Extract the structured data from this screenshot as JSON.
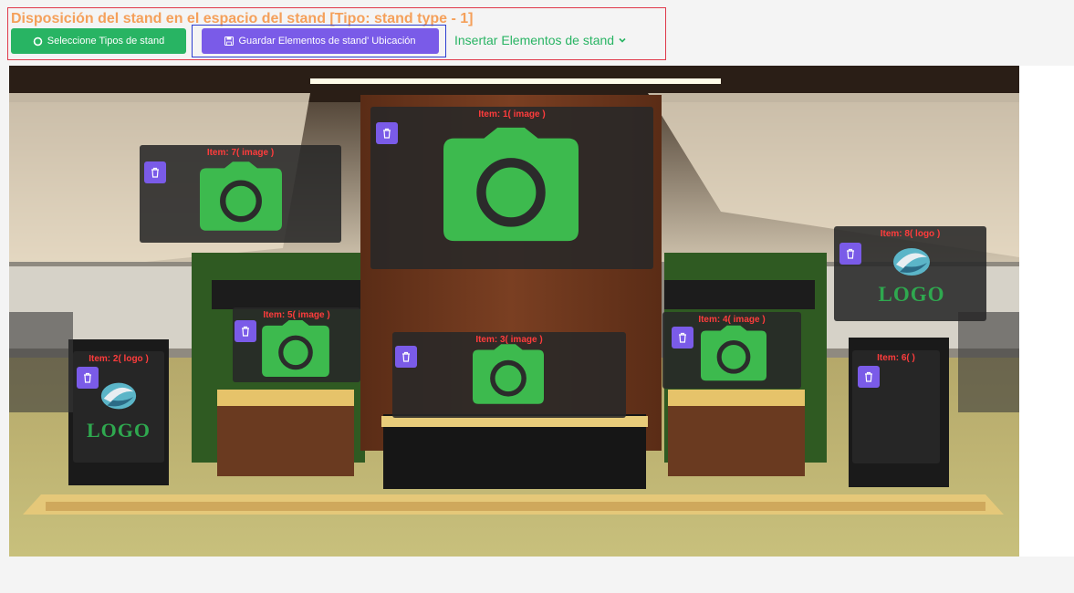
{
  "page": {
    "title": "Disposición del stand en el espacio del stand [Tipo: stand type - 1]"
  },
  "toolbar": {
    "select_types_label": "Seleccione Tipos de stand",
    "save_label": "Guardar Elementos de stand' Ubicación",
    "insert_label": "Insertar Elementos de stand"
  },
  "items": {
    "item1": {
      "label": "Item: 1( image )"
    },
    "item2": {
      "label": "Item: 2( logo )",
      "logo_text": "LOGO"
    },
    "item3": {
      "label": "Item: 3( image )"
    },
    "item4": {
      "label": "Item: 4( image )"
    },
    "item5": {
      "label": "Item: 5( image )"
    },
    "item6": {
      "label": "Item: 6( )"
    },
    "item7": {
      "label": "Item: 7( image )"
    },
    "item8": {
      "label": "Item: 8( logo )",
      "logo_text": "LOGO"
    }
  },
  "colors": {
    "accent_green": "#28b463",
    "accent_purple": "#7a5be8",
    "label_red": "#ff3c3c",
    "title_orange": "#f5a05a"
  },
  "icons": {
    "delete": "trash-icon",
    "image_placeholder": "camera-icon",
    "select": "circle-icon",
    "save": "floppy-disk-icon",
    "dropdown": "chevron-down-icon"
  }
}
